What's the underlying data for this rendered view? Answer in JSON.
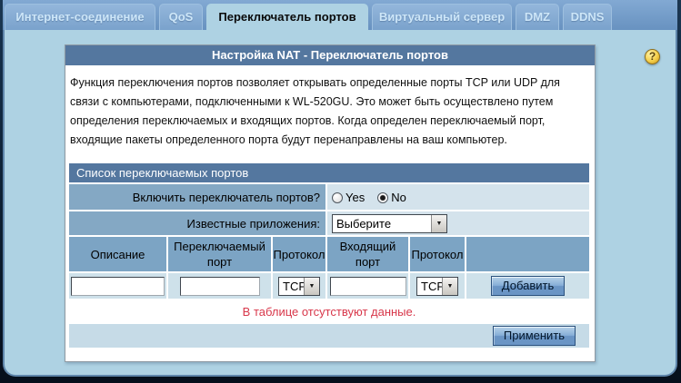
{
  "tabs": [
    {
      "label": "Интернет-соединение",
      "active": false
    },
    {
      "label": "QoS",
      "active": false
    },
    {
      "label": "Переключатель портов",
      "active": true
    },
    {
      "label": "Виртуальный сервер",
      "active": false
    },
    {
      "label": "DMZ",
      "active": false
    },
    {
      "label": "DDNS",
      "active": false
    }
  ],
  "help_icon_glyph": "?",
  "panel": {
    "title": "Настройка NAT - Переключатель портов",
    "description": "Функция переключения портов позволяет открывать определенные порты TCP или UDP для связи с компьютерами, подключенными к WL-520GU. Это может быть осуществлено путем определения переключаемых и входящих портов. Когда определен переключаемый порт, входящие пакеты определенного порта будут перенаправлены на ваш компьютер.",
    "table": {
      "section_title": "Список переключаемых портов",
      "enable_label": "Включить переключатель портов?",
      "enable_options": {
        "yes": {
          "label": "Yes",
          "checked": false
        },
        "no": {
          "label": "No",
          "checked": true
        }
      },
      "known_apps_label": "Известные приложения:",
      "known_apps_value": "Выберите",
      "columns": [
        "Описание",
        "Переключаемый порт",
        "Протокол",
        "Входящий порт",
        "Протокол",
        ""
      ],
      "inputs": {
        "description": "",
        "trigger_port": "",
        "incoming_port": ""
      },
      "protocol_trigger": "TCP",
      "protocol_incoming": "TCP",
      "add_button": "Добавить",
      "empty_message": "В таблице отсутствуют данные.",
      "apply_button": "Применить"
    }
  },
  "colors": {
    "accent_dark": "#54779F",
    "tab_bar": "#6F9AC7",
    "page_bg": "#AED2E3",
    "header_cell": "#7CA4C4",
    "label_cell": "#84A8C4",
    "value_cell": "#D4E3EC",
    "error_text": "#D8374A"
  },
  "select_arrow_glyph": "▼"
}
